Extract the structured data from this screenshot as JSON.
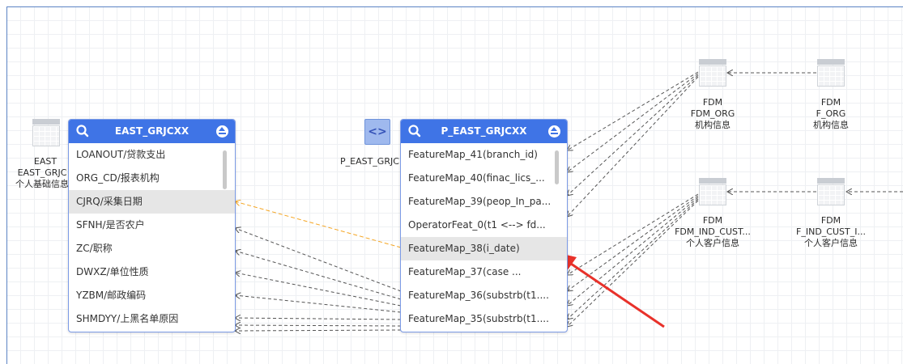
{
  "source_node": {
    "type_label": "EAST",
    "name_label": "EAST_GRJC",
    "desc_label": "个人基础信息"
  },
  "east_panel": {
    "title": "EAST_GRJCXX",
    "rows": [
      "LOANOUT/贷款支出",
      "ORG_CD/报表机构",
      "CJRQ/采集日期",
      "SFNH/是否农户",
      "ZC/职称",
      "DWXZ/单位性质",
      "YZBM/邮政编码",
      "SHMDYY/上黑名单原因"
    ],
    "highlighted_index": 2
  },
  "process_node": {
    "icon_glyph": "<>",
    "label": "P_EAST_GRJC"
  },
  "p_panel": {
    "title": "P_EAST_GRJCXX",
    "rows": [
      "FeatureMap_41(branch_id)",
      "FeatureMap_40(finac_lics_...",
      "FeatureMap_39(peop_In_pa...",
      "OperatorFeat_0(t1 <--> fd...",
      "FeatureMap_38(i_date)",
      "FeatureMap_37(case       ...",
      "FeatureMap_36(substrb(t1....",
      "FeatureMap_35(substrb(t1...."
    ],
    "highlighted_index": 4
  },
  "fdm_nodes": [
    {
      "type_label": "FDM",
      "name_label": "FDM_ORG",
      "desc_label": "机构信息"
    },
    {
      "type_label": "FDM",
      "name_label": "F_ORG",
      "desc_label": "机构信息"
    },
    {
      "type_label": "FDM",
      "name_label": "FDM_IND_CUST...",
      "desc_label": "个人客户信息"
    },
    {
      "type_label": "FDM",
      "name_label": "F_IND_CUST_I...",
      "desc_label": "个人客户信息"
    }
  ],
  "colors": {
    "panel_header": "#3f74e6",
    "highlight_link": "#f5a623",
    "annotation_arrow": "#e8312a"
  },
  "icons": [
    "search-icon",
    "collapse-up-icon",
    "table-icon",
    "process-icon"
  ]
}
